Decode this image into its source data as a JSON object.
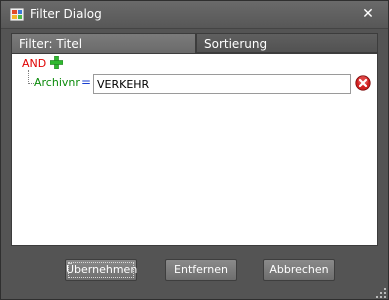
{
  "window": {
    "title": "Filter Dialog",
    "close_glyph": "✕"
  },
  "tabs": [
    {
      "label": "Filter: Titel",
      "active": true
    },
    {
      "label": "Sortierung",
      "active": false
    }
  ],
  "filter": {
    "operator_group": "AND",
    "rule": {
      "field": "Archivnr",
      "operator": "=",
      "value": "VERKEHR"
    }
  },
  "buttons": {
    "apply": "Übernehmen",
    "remove": "Entfernen",
    "cancel": "Abbrechen"
  },
  "icons": {
    "app": "dialog-app-icon",
    "add": "plus-icon",
    "delete": "remove-icon",
    "close": "close-icon",
    "resize": "resize-grip-icon"
  },
  "colors": {
    "and_label": "#e00000",
    "field_label": "#0a8a0a",
    "operator_label": "#1a3fd0",
    "plus": "#2fb82f",
    "remove": "#d02020"
  }
}
